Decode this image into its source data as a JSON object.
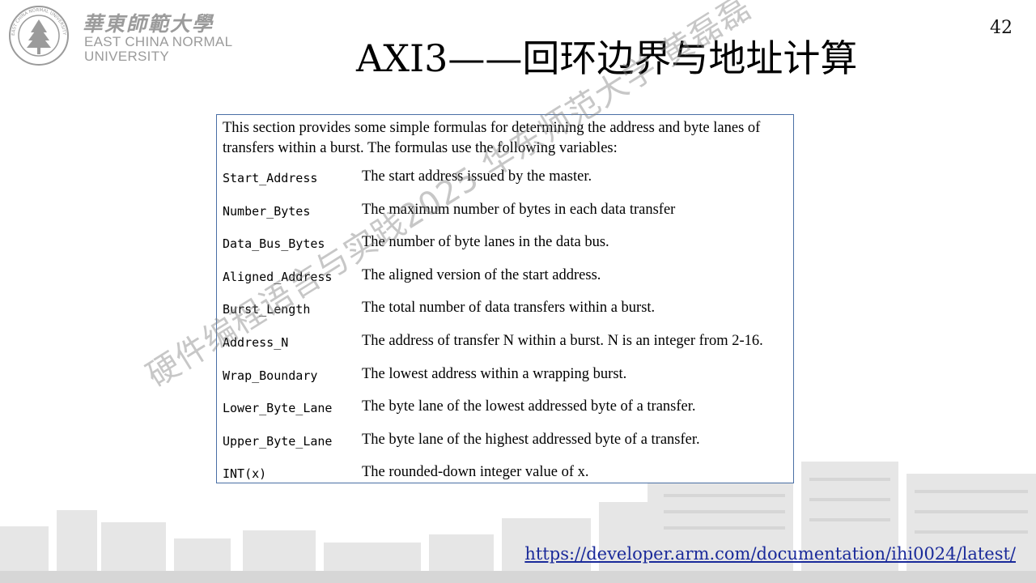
{
  "logo": {
    "name_cn": "華東師範大學",
    "name_en_line1": "EAST CHINA NORMAL",
    "name_en_line2": "UNIVERSITY",
    "seal_text": "EAST CHINA NORMAL UNIVERSITY"
  },
  "page_number": "42",
  "title": "AXI3——回环边界与地址计算",
  "spec": {
    "intro": "This section provides some simple formulas for determining the address and byte lanes of transfers within a burst. The formulas use the following variables:",
    "variables": [
      {
        "name": "Start_Address",
        "description": "The start address issued by the master."
      },
      {
        "name": "Number_Bytes",
        "description": "The maximum number of bytes in each data transfer"
      },
      {
        "name": "Data_Bus_Bytes",
        "description": "The number of byte lanes in the data bus."
      },
      {
        "name": "Aligned_Address",
        "description": "The aligned version of the start address."
      },
      {
        "name": "Burst_Length",
        "description": "The total number of data transfers within a burst."
      },
      {
        "name": "Address_N",
        "description": "The address of transfer N within a burst. N is an integer from 2-16."
      },
      {
        "name": "Wrap_Boundary",
        "description": "The lowest address within a wrapping burst."
      },
      {
        "name": "Lower_Byte_Lane",
        "description": "The byte lane of the lowest addressed byte of a transfer."
      },
      {
        "name": "Upper_Byte_Lane",
        "description": "The byte lane of the highest addressed byte of a transfer."
      },
      {
        "name": "INT(x)",
        "description": "The rounded-down integer value of x."
      }
    ]
  },
  "watermark": "硬件编程语言与实践2025 华东师范大学 黄磊磊",
  "reference_link": "https://developer.arm.com/documentation/ihi0024/latest/",
  "colors": {
    "link": "#1a2a9a",
    "box_border": "#4a6fa5",
    "logo_gray": "#9b9b9b"
  }
}
